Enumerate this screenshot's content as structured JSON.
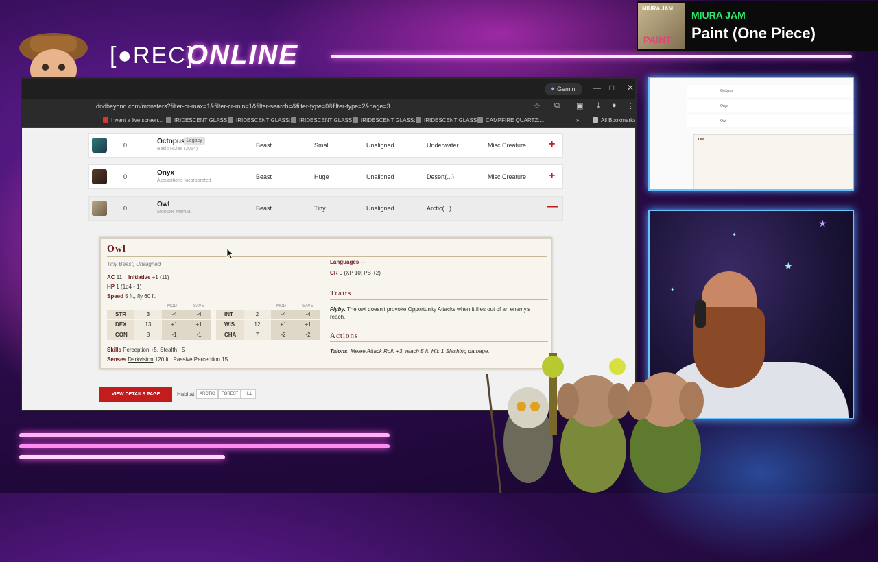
{
  "overlay": {
    "rec_label": "[●REC]",
    "online_label": "ONLINE",
    "now_playing": {
      "label": "MIURA JAM",
      "title": "Paint (One Piece)",
      "cover_top": "MIURA JAM",
      "cover_bottom": "PAINT"
    }
  },
  "browser": {
    "gemini_label": "Gemini",
    "window_controls": [
      "—",
      "□",
      "✕"
    ],
    "url": "dndbeyond.com/monsters?filter-cr-max=1&filter-cr-min=1&filter-search=&filter-type=0&filter-type=2&page=3",
    "bookmarks": [
      "I want a live screen...",
      "IRIDESCENT GLASS:...",
      "IRIDESCENT GLASS:...",
      "IRIDESCENT GLASS:...",
      "IRIDESCENT GLASS:...",
      "IRIDESCENT GLASS:...",
      "CAMPFIRE QUARTZ:..."
    ],
    "all_bookmarks": "All Bookmarks"
  },
  "monsters": [
    {
      "name": "Octopus",
      "badge": "Legacy",
      "source": "Basic Rules (2014)",
      "cr": "0",
      "type": "Beast",
      "size": "Small",
      "alignment": "Unaligned",
      "habitat": "Underwater",
      "extra": "Misc Creature",
      "toggle": "+"
    },
    {
      "name": "Onyx",
      "badge": "",
      "source": "Acquisitions Incorporated",
      "cr": "0",
      "type": "Beast",
      "size": "Huge",
      "alignment": "Unaligned",
      "habitat": "Desert(...)",
      "extra": "Misc Creature",
      "toggle": "+"
    },
    {
      "name": "Owl",
      "badge": "",
      "source": "Monster Manual",
      "cr": "0",
      "type": "Beast",
      "size": "Tiny",
      "alignment": "Unaligned",
      "habitat": "Arctic(...)",
      "extra": "",
      "toggle": "—"
    }
  ],
  "statblock": {
    "name": "Owl",
    "type_line": "Tiny Beast, Unaligned",
    "ac_label": "AC",
    "ac_value": "11",
    "init_label": "Initiative",
    "init_value": "+1 (11)",
    "hp_label": "HP",
    "hp_value": "1 (1d4 - 1)",
    "speed_label": "Speed",
    "speed_value": "5 ft., fly 60 ft.",
    "mod_header": "MOD",
    "save_header": "SAVE",
    "abilities_left": [
      {
        "name": "STR",
        "score": "3",
        "mod": "-4",
        "save": "-4"
      },
      {
        "name": "DEX",
        "score": "13",
        "mod": "+1",
        "save": "+1"
      },
      {
        "name": "CON",
        "score": "8",
        "mod": "-1",
        "save": "-1"
      }
    ],
    "abilities_right": [
      {
        "name": "INT",
        "score": "2",
        "mod": "-4",
        "save": "-4"
      },
      {
        "name": "WIS",
        "score": "12",
        "mod": "+1",
        "save": "+1"
      },
      {
        "name": "CHA",
        "score": "7",
        "mod": "-2",
        "save": "-2"
      }
    ],
    "skills_label": "Skills",
    "skills_value": "Perception +5, Stealth +5",
    "senses_label": "Senses",
    "senses_link": "Darkvision",
    "senses_value": "120 ft., Passive Perception 15",
    "languages_label": "Languages",
    "languages_value": "—",
    "cr_label": "CR",
    "cr_value": "0 (XP 10; PB +2)",
    "traits_heading": "Traits",
    "trait_name": "Flyby.",
    "trait_text": "The owl doesn't provoke Opportunity Attacks when it flies out of an enemy's reach.",
    "actions_heading": "Actions",
    "action_name": "Talons.",
    "action_text": "Melee Attack Roll: +3, reach 5 ft. Hit: 1 Slashing damage."
  },
  "footer": {
    "details_button": "VIEW DETAILS PAGE",
    "habitat_label": "Habitat:",
    "habitat_tags": [
      "ARCTIC",
      "FOREST",
      "HILL"
    ]
  },
  "preview": {
    "rows": [
      "Octopus",
      "Onyx",
      "Owl"
    ],
    "block_title": "Owl"
  },
  "colors": {
    "accent_red": "#c21c1c",
    "statblock_heading": "#6b1d1d",
    "neon_blue": "#6ec1ff",
    "neon_pink": "#ff57e8",
    "spotify_green": "#2ee66c"
  }
}
